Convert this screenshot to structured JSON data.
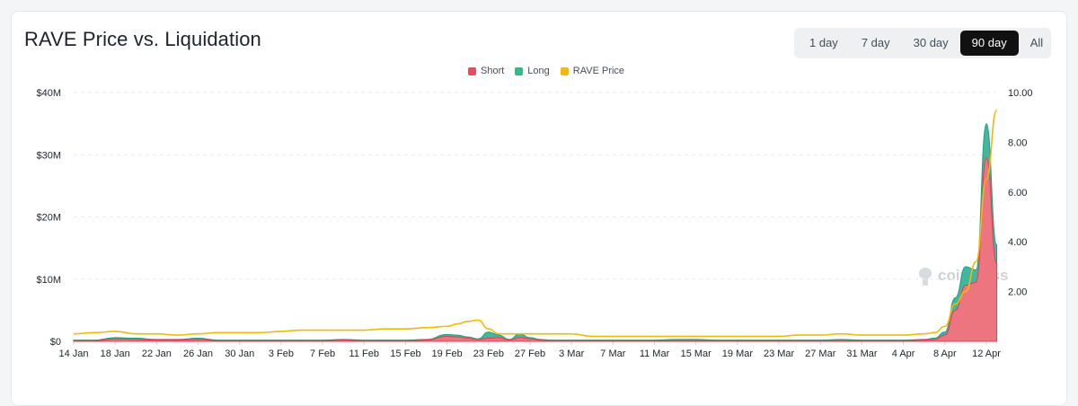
{
  "title": "RAVE Price vs. Liquidation",
  "range_tabs": [
    {
      "label": "1 day",
      "active": false
    },
    {
      "label": "7 day",
      "active": false
    },
    {
      "label": "30 day",
      "active": false
    },
    {
      "label": "90 day",
      "active": true
    },
    {
      "label": "All",
      "active": false
    }
  ],
  "watermark": "coinglass",
  "colors": {
    "short": "#f6465d",
    "long": "#2ebd85",
    "price": "#f0b90b"
  },
  "chart_data": {
    "type": "area",
    "legend": [
      "Short",
      "Long",
      "RAVE Price"
    ],
    "legend_position": "top-center",
    "grid": true,
    "x_ticks": [
      "14 Jan",
      "18 Jan",
      "22 Jan",
      "26 Jan",
      "30 Jan",
      "3 Feb",
      "7 Feb",
      "11 Feb",
      "15 Feb",
      "19 Feb",
      "23 Feb",
      "27 Feb",
      "3 Mar",
      "7 Mar",
      "11 Mar",
      "15 Mar",
      "19 Mar",
      "23 Mar",
      "27 Mar",
      "31 Mar",
      "4 Apr",
      "8 Apr",
      "12 Apr"
    ],
    "y_left": {
      "ticks": [
        "$0",
        "$10M",
        "$20M",
        "$30M",
        "$40M"
      ],
      "range": [
        0,
        40000000
      ]
    },
    "y_right": {
      "ticks": [
        "2.00",
        "4.00",
        "6.00",
        "8.00",
        "10.00"
      ],
      "range": [
        0,
        10
      ]
    },
    "x": [
      "14 Jan",
      "16 Jan",
      "18 Jan",
      "20 Jan",
      "22 Jan",
      "24 Jan",
      "26 Jan",
      "28 Jan",
      "30 Jan",
      "1 Feb",
      "3 Feb",
      "5 Feb",
      "7 Feb",
      "9 Feb",
      "11 Feb",
      "13 Feb",
      "15 Feb",
      "17 Feb",
      "19 Feb",
      "20 Feb",
      "21 Feb",
      "22 Feb",
      "23 Feb",
      "24 Feb",
      "25 Feb",
      "26 Feb",
      "27 Feb",
      "28 Feb",
      "1 Mar",
      "3 Mar",
      "5 Mar",
      "7 Mar",
      "9 Mar",
      "11 Mar",
      "13 Mar",
      "15 Mar",
      "17 Mar",
      "19 Mar",
      "21 Mar",
      "23 Mar",
      "25 Mar",
      "27 Mar",
      "29 Mar",
      "31 Mar",
      "2 Apr",
      "4 Apr",
      "6 Apr",
      "7 Apr",
      "8 Apr",
      "9 Apr",
      "10 Apr",
      "11 Apr",
      "12 Apr",
      "13 Apr"
    ],
    "series": [
      {
        "name": "Short",
        "values": [
          0.1,
          0.1,
          0.4,
          0.3,
          0.2,
          0.2,
          0.3,
          0.1,
          0.1,
          0.1,
          0.1,
          0.1,
          0.1,
          0.2,
          0.1,
          0.1,
          0.1,
          0.2,
          0.8,
          0.7,
          0.5,
          0.3,
          0.5,
          0.6,
          0.2,
          0.6,
          0.4,
          0.2,
          0.1,
          0.1,
          0.1,
          0.1,
          0.1,
          0.1,
          0.1,
          0.1,
          0.1,
          0.1,
          0.1,
          0.1,
          0.1,
          0.1,
          0.1,
          0.1,
          0.1,
          0.1,
          0.2,
          0.3,
          1.0,
          5.0,
          9.0,
          9.5,
          29.5,
          12.5
        ]
      },
      {
        "name": "Long",
        "values": [
          0.2,
          0.2,
          0.6,
          0.5,
          0.3,
          0.3,
          0.5,
          0.2,
          0.2,
          0.2,
          0.2,
          0.2,
          0.2,
          0.3,
          0.2,
          0.2,
          0.2,
          0.3,
          1.1,
          1.0,
          0.7,
          0.4,
          1.5,
          1.0,
          0.3,
          1.2,
          0.6,
          0.3,
          0.2,
          0.2,
          0.2,
          0.2,
          0.2,
          0.2,
          0.3,
          0.3,
          0.2,
          0.2,
          0.2,
          0.2,
          0.2,
          0.2,
          0.3,
          0.2,
          0.2,
          0.2,
          0.3,
          0.5,
          1.5,
          7.0,
          12.0,
          11.5,
          35.0,
          15.5
        ]
      },
      {
        "name": "RAVE Price",
        "values": [
          0.3,
          0.35,
          0.4,
          0.3,
          0.3,
          0.25,
          0.3,
          0.35,
          0.35,
          0.35,
          0.4,
          0.45,
          0.45,
          0.45,
          0.45,
          0.5,
          0.5,
          0.55,
          0.6,
          0.7,
          0.8,
          0.85,
          0.5,
          0.3,
          0.3,
          0.3,
          0.3,
          0.3,
          0.3,
          0.3,
          0.2,
          0.2,
          0.2,
          0.2,
          0.2,
          0.2,
          0.2,
          0.2,
          0.2,
          0.2,
          0.25,
          0.25,
          0.3,
          0.25,
          0.25,
          0.25,
          0.3,
          0.35,
          0.6,
          1.5,
          2.0,
          3.2,
          6.5,
          9.3
        ]
      }
    ]
  }
}
